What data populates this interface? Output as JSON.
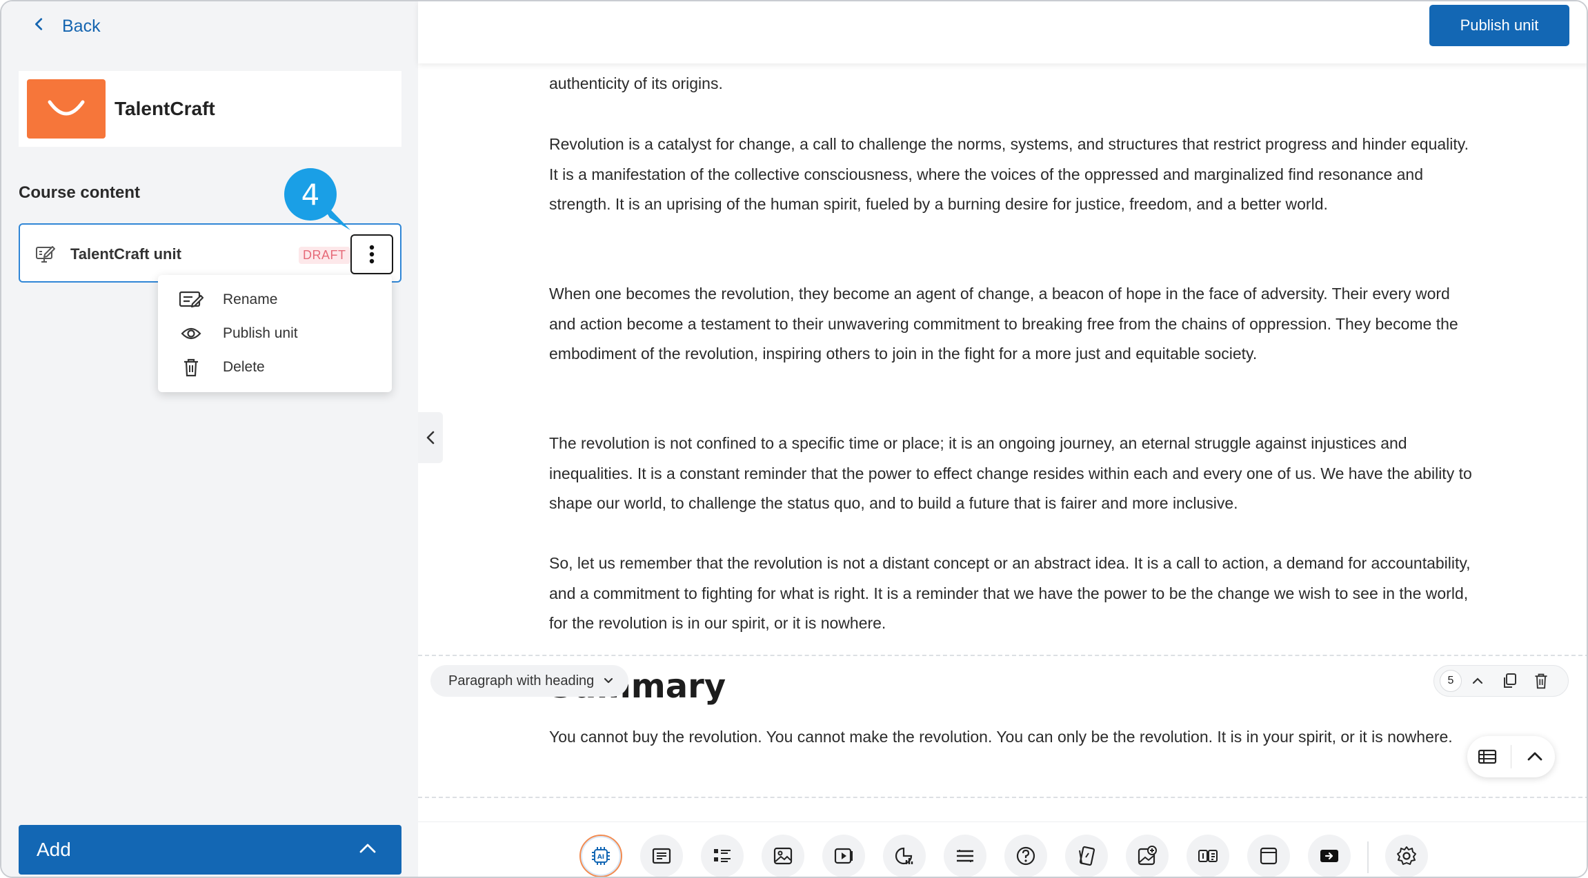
{
  "sidebar": {
    "back_label": "Back",
    "brand_name": "TalentCraft",
    "course_content_label": "Course content",
    "callout_number": "4",
    "unit": {
      "title": "TalentCraft unit",
      "status": "DRAFT"
    },
    "menu": [
      {
        "label": "Rename",
        "icon": "rename-icon"
      },
      {
        "label": "Publish unit",
        "icon": "eye-icon"
      },
      {
        "label": "Delete",
        "icon": "trash-icon"
      }
    ],
    "add_label": "Add"
  },
  "header": {
    "publish_label": "Publish unit"
  },
  "content": {
    "paragraphs": [
      "authenticity of its origins.",
      "Revolution is a catalyst for change, a call to challenge the norms, systems, and structures that restrict progress and hinder equality. It is a manifestation of the collective consciousness, where the voices of the oppressed and marginalized find resonance and strength. It is an uprising of the human spirit, fueled by a burning desire for justice, freedom, and a better world.",
      "When one becomes the revolution, they become an agent of change, a beacon of hope in the face of adversity. Their every word and action become a testament to their unwavering commitment to breaking free from the chains of oppression. They become the embodiment of the revolution, inspiring others to join in the fight for a more just and equitable society.",
      "The revolution is not confined to a specific time or place; it is an ongoing journey, an eternal struggle against injustices and inequalities. It is a constant reminder that the power to effect change resides within each and every one of us. We have the ability to shape our world, to challenge the status quo, and to build a future that is fairer and more inclusive.",
      "So, let us remember that the revolution is not a distant concept or an abstract idea. It is a call to action, a demand for accountability, and a commitment to fighting for what is right. It is a reminder that we have the power to be the change we wish to see in the world, for the revolution is in our spirit, or it is nowhere."
    ],
    "summary_heading": "Summary",
    "summary_text": "You cannot buy the revolution. You cannot make the revolution. You can only be the revolution. It is in your spirit, or it is nowhere.",
    "block_type_label": "Paragraph with heading",
    "block_index": "5"
  },
  "toolbar": {
    "tools": [
      "ai-icon",
      "text-block-icon",
      "list-icon",
      "image-icon",
      "video-icon",
      "chart-icon",
      "divider-block-icon",
      "question-icon",
      "flashcard-icon",
      "image-add-icon",
      "compare-icon",
      "frame-icon",
      "embed-icon",
      "settings-icon"
    ]
  },
  "colors": {
    "accent": "#1367b4",
    "brand": "#f6763a",
    "callout": "#1a9fe6",
    "draft_bg": "#fde8ea",
    "draft_text": "#e66a78"
  }
}
